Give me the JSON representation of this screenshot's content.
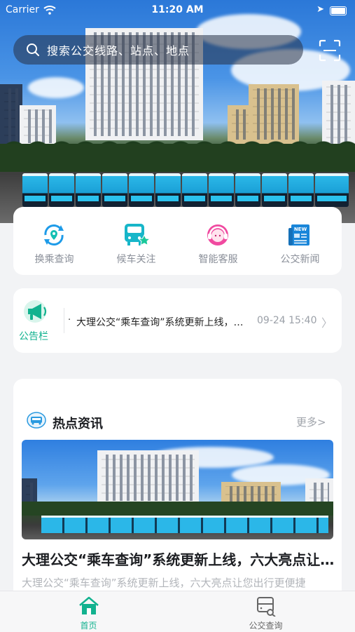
{
  "status_bar": {
    "carrier": "Carrier",
    "time": "11:20 AM"
  },
  "search": {
    "placeholder": "搜索公交线路、站点、地点"
  },
  "quick_actions": [
    {
      "label": "换乘查询",
      "icon": "transfer-icon"
    },
    {
      "label": "候车关注",
      "icon": "bus-star-icon"
    },
    {
      "label": "智能客服",
      "icon": "customer-service-icon"
    },
    {
      "label": "公交新闻",
      "icon": "news-icon"
    }
  ],
  "notice": {
    "label": "公告栏",
    "text": "大理公交“乘车查询”系统更新上线，六大亮点让您出行更便捷",
    "date": "09-24 15:40"
  },
  "hot_news": {
    "title": "热点资讯",
    "more": "更多>",
    "headline": "大理公交“乘车查询”系统更新上线，六大亮点让您出行更便捷",
    "summary": "大理公交“乘车查询”系统更新上线，六大亮点让您出行更便捷"
  },
  "tabs": [
    {
      "label": "首页",
      "active": true
    },
    {
      "label": "公交查询",
      "active": false
    }
  ],
  "colors": {
    "accent": "#12b28f",
    "inactive": "#666666"
  }
}
